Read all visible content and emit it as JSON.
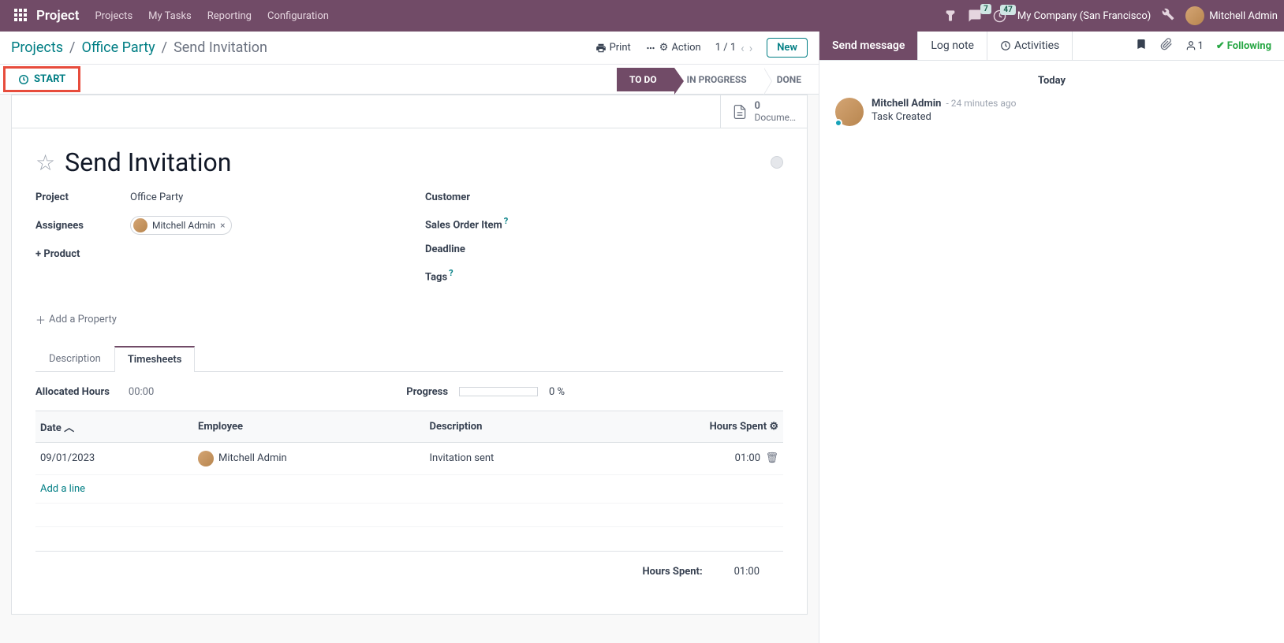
{
  "nav": {
    "brand": "Project",
    "items": [
      "Projects",
      "My Tasks",
      "Reporting",
      "Configuration"
    ],
    "msg_badge": "7",
    "clock_badge": "47",
    "company": "My Company (San Francisco)",
    "user": "Mitchell Admin"
  },
  "cp": {
    "bc_projects": "Projects",
    "bc_office": "Office Party",
    "bc_task": "Send Invitation",
    "print": "Print",
    "action": "Action",
    "pager": "1 / 1",
    "new": "New",
    "start": "START",
    "status": {
      "todo": "TO DO",
      "inprog": "IN PROGRESS",
      "done": "DONE"
    },
    "doc_count": "0",
    "doc_label": "Docume…"
  },
  "task": {
    "title": "Send Invitation",
    "labels": {
      "project": "Project",
      "assignees": "Assignees",
      "product": "+ Product",
      "customer": "Customer",
      "soi": "Sales Order Item",
      "deadline": "Deadline",
      "tags": "Tags",
      "add_prop": "Add a Property"
    },
    "project_val": "Office Party",
    "assignee": "Mitchell Admin"
  },
  "tabs": {
    "desc": "Description",
    "ts": "Timesheets"
  },
  "ts": {
    "allocated_label": "Allocated Hours",
    "allocated_val": "00:00",
    "progress_label": "Progress",
    "progress_val": "0 %",
    "headers": {
      "date": "Date",
      "emp": "Employee",
      "desc": "Description",
      "hours": "Hours Spent"
    },
    "rows": [
      {
        "date": "09/01/2023",
        "emp": "Mitchell Admin",
        "desc": "Invitation sent",
        "hours": "01:00"
      }
    ],
    "addline": "Add a line",
    "total_label": "Hours Spent:",
    "total_val": "01:00"
  },
  "chatter": {
    "send": "Send message",
    "log": "Log note",
    "activities": "Activities",
    "follower_count": "1",
    "following": "Following",
    "today": "Today",
    "msg": {
      "author": "Mitchell Admin",
      "time": "- 24 minutes ago",
      "body": "Task Created"
    }
  }
}
